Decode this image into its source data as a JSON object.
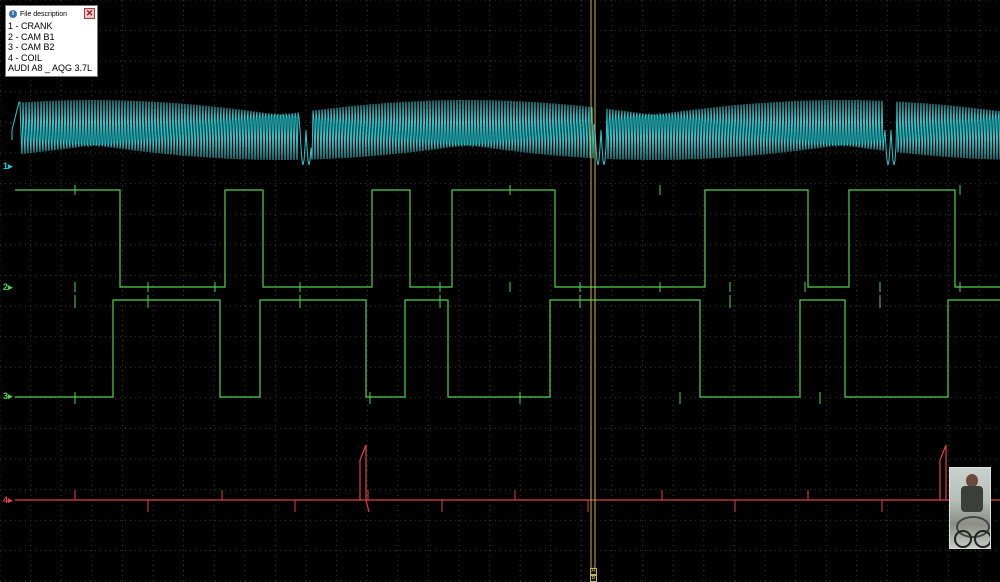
{
  "description_panel": {
    "title": "File description",
    "close_glyph": "✕",
    "info_glyph": "i",
    "lines": [
      "1 - CRANK",
      "2 - CAM B1",
      "3 - CAM B2",
      "4 - COIL",
      "AUDI A8 _ AQG 3.7L"
    ]
  },
  "channels": [
    {
      "id": "1",
      "marker": "1",
      "color": "#28c8d0"
    },
    {
      "id": "2",
      "marker": "2",
      "color": "#4ed34e"
    },
    {
      "id": "3",
      "marker": "3",
      "color": "#4ed34e"
    },
    {
      "id": "4",
      "marker": "4",
      "color": "#e04040"
    }
  ],
  "cursor": {
    "marker_bottom": "B",
    "marker_top": "A",
    "color": "#c8b04a"
  },
  "colors": {
    "background": "#000000",
    "grid": "#3a3a3a",
    "crank": "#28c8d0",
    "cam": "#4ed34e",
    "coil": "#e04040"
  },
  "thumbnail": {
    "icon": "webcam-thumbnail"
  }
}
